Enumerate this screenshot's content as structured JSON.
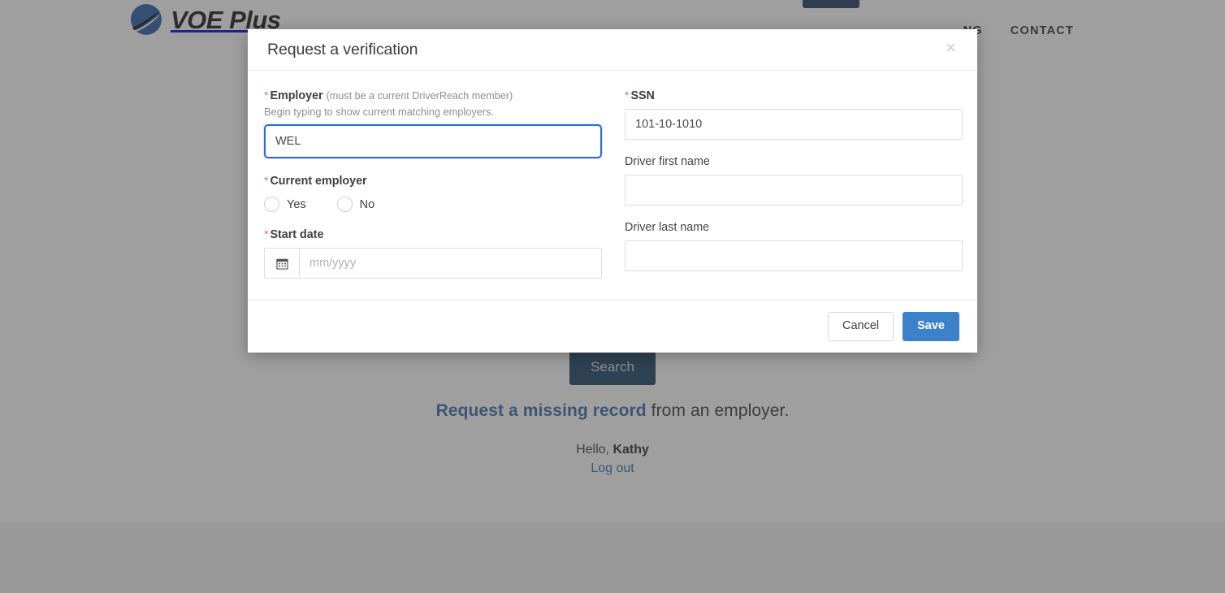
{
  "site": {
    "brand_name": "VOE Plus",
    "brand_icon": "swoosh-logo-icon",
    "nav": [
      {
        "label": "NG",
        "name": "nav-link-pricing"
      },
      {
        "label": "CONTACT",
        "name": "nav-link-contact"
      }
    ],
    "header_cta_label": "",
    "search_button_label": "Search",
    "missing_record_link": "Request a missing record",
    "missing_record_rest": " from an employer.",
    "greeting_prefix": "Hello, ",
    "greeting_name": "Kathy",
    "logout_label": "Log out",
    "colors": {
      "brand_navy": "#1f4568",
      "link_blue": "#3a6da6",
      "overlay": "rgba(64,64,64,0.5)"
    }
  },
  "modal": {
    "title": "Request a verification",
    "close_icon": "close-icon",
    "left_column": {
      "employer": {
        "label": "Employer",
        "label_note": "(must be a current DriverReach member)",
        "required": true,
        "help": "Begin typing to show current matching employers.",
        "value": "WEL",
        "placeholder": "",
        "focused": true
      },
      "current_employer": {
        "label": "Current employer",
        "required": true,
        "options": [
          {
            "label": "Yes",
            "value": "yes",
            "selected": false
          },
          {
            "label": "No",
            "value": "no",
            "selected": false
          }
        ]
      },
      "start_date": {
        "label": "Start date",
        "required": true,
        "icon": "calendar-icon",
        "value": "",
        "placeholder": "mm/yyyy"
      }
    },
    "right_column": {
      "ssn": {
        "label": "SSN",
        "required": true,
        "value": "101-10-1010",
        "placeholder": ""
      },
      "driver_first_name": {
        "label": "Driver first name",
        "required": false,
        "value": "",
        "placeholder": ""
      },
      "driver_last_name": {
        "label": "Driver last name",
        "required": false,
        "value": "",
        "placeholder": ""
      }
    },
    "footer": {
      "cancel_label": "Cancel",
      "save_label": "Save"
    },
    "colors": {
      "focus_blue": "#2b6cd4",
      "save_blue": "#3b82ca",
      "required_star": "#e06c6c"
    }
  }
}
